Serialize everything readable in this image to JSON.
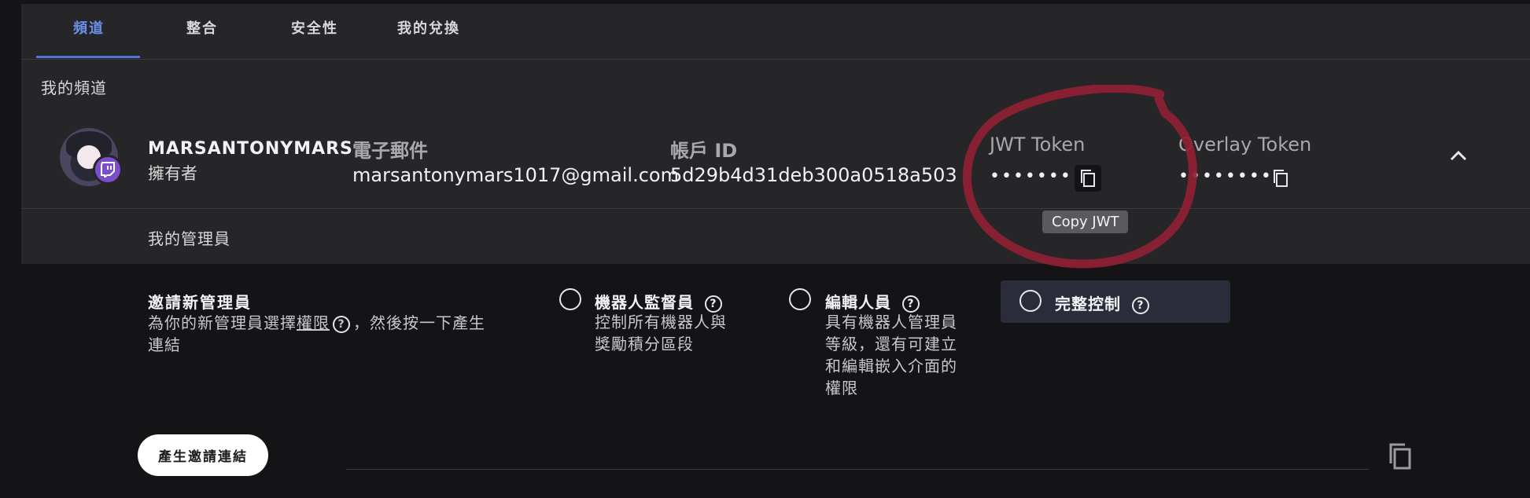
{
  "tabs": [
    {
      "label": "頻道",
      "active": true
    },
    {
      "label": "整合",
      "active": false
    },
    {
      "label": "安全性",
      "active": false
    },
    {
      "label": "我的兌換",
      "active": false
    }
  ],
  "section": {
    "title": "我的頻道"
  },
  "channel": {
    "name": "MARSANTONYMARS",
    "role": "擁有者",
    "email_label": "電子郵件",
    "email": "marsantonymars1017@gmail.com",
    "account_id_label": "帳戶 ID",
    "account_id": "5d29b4d31deb300a0518a503",
    "jwt_label": "JWT Token",
    "jwt_masked": "••••••••",
    "overlay_label": "Overlay Token",
    "overlay_masked": "••••••••",
    "copy_tooltip": "Copy JWT"
  },
  "managers": {
    "title": "我的管理員",
    "invite_title": "邀請新管理員",
    "invite_desc_before": "為你的新管理員選擇",
    "invite_desc_link": "權限",
    "invite_desc_after": "，然後按一下產生",
    "invite_desc_line2": "連結",
    "options": [
      {
        "title": "機器人監督員",
        "desc": [
          "控制所有機器人與",
          "獎勵積分區段"
        ]
      },
      {
        "title": "編輯人員",
        "desc": [
          "具有機器人管理員",
          "等級，還有可建立",
          "和編輯嵌入介面的",
          "權限"
        ]
      },
      {
        "title": "完整控制",
        "desc": []
      }
    ],
    "generate_button": "產生邀請連結"
  },
  "icons": {
    "help": "?",
    "copy": "copy-icon",
    "chevron": "chevron-up-icon",
    "twitch": "twitch-icon"
  },
  "colors": {
    "accent": "#4f73d6",
    "annotation": "#8e1f33",
    "badge": "#7b4fc9"
  }
}
